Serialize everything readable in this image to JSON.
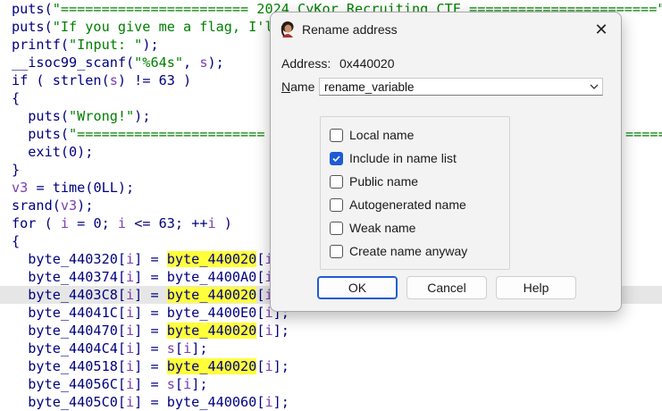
{
  "code_lines": [
    {
      "parts": [
        {
          "t": "puts(",
          "c": ""
        },
        {
          "t": "\"======================= 2024 CyKor Recruiting CTF =======================\"",
          "c": "str"
        },
        {
          "t": ");",
          "c": ""
        }
      ]
    },
    {
      "parts": [
        {
          "t": "puts(",
          "c": ""
        },
        {
          "t": "\"If you give me a flag, I'l",
          "c": "str"
        }
      ]
    },
    {
      "parts": [
        {
          "t": "printf(",
          "c": ""
        },
        {
          "t": "\"Input: \"",
          "c": "str"
        },
        {
          "t": ");",
          "c": ""
        }
      ]
    },
    {
      "parts": [
        {
          "t": "__isoc99_scanf(",
          "c": ""
        },
        {
          "t": "\"%64s\"",
          "c": "str"
        },
        {
          "t": ", ",
          "c": ""
        },
        {
          "t": "s",
          "c": "pv"
        },
        {
          "t": ");",
          "c": ""
        }
      ]
    },
    {
      "parts": [
        {
          "t": "if ( strlen(",
          "c": ""
        },
        {
          "t": "s",
          "c": "pv"
        },
        {
          "t": ") != 63 )",
          "c": ""
        }
      ]
    },
    {
      "parts": [
        {
          "t": "{",
          "c": ""
        }
      ]
    },
    {
      "parts": [
        {
          "t": "  puts(",
          "c": ""
        },
        {
          "t": "\"Wrong!\"",
          "c": "str"
        },
        {
          "t": ");",
          "c": ""
        }
      ]
    },
    {
      "parts": [
        {
          "t": "  puts(",
          "c": ""
        },
        {
          "t": "\"=======================",
          "c": "str"
        }
      ],
      "right": "=====\""
    },
    {
      "parts": [
        {
          "t": "  exit(0);",
          "c": ""
        }
      ]
    },
    {
      "parts": [
        {
          "t": "}",
          "c": ""
        }
      ]
    },
    {
      "parts": [
        {
          "t": "v3",
          "c": "pv"
        },
        {
          "t": " = time(0LL);",
          "c": ""
        }
      ]
    },
    {
      "parts": [
        {
          "t": "srand(",
          "c": ""
        },
        {
          "t": "v3",
          "c": "pv"
        },
        {
          "t": ");",
          "c": ""
        }
      ]
    },
    {
      "parts": [
        {
          "t": "for ( ",
          "c": ""
        },
        {
          "t": "i",
          "c": "pv"
        },
        {
          "t": " = 0; ",
          "c": ""
        },
        {
          "t": "i",
          "c": "pv"
        },
        {
          "t": " <= 63; ++",
          "c": ""
        },
        {
          "t": "i",
          "c": "pv"
        },
        {
          "t": " )",
          "c": ""
        }
      ]
    },
    {
      "parts": [
        {
          "t": "{",
          "c": ""
        }
      ]
    },
    {
      "parts": [
        {
          "t": "  byte_440320[",
          "c": ""
        },
        {
          "t": "i",
          "c": "pv"
        },
        {
          "t": "] = ",
          "c": ""
        },
        {
          "t": "byte_440020",
          "c": "hl"
        },
        {
          "t": "[",
          "c": ""
        },
        {
          "t": "i",
          "c": "pv"
        }
      ]
    },
    {
      "parts": [
        {
          "t": "  byte_440374[",
          "c": ""
        },
        {
          "t": "i",
          "c": "pv"
        },
        {
          "t": "] = byte_4400A0[",
          "c": ""
        },
        {
          "t": "i",
          "c": "pv"
        }
      ]
    },
    {
      "parts": [
        {
          "t": "  byte_4403C8[",
          "c": ""
        },
        {
          "t": "i",
          "c": "pv"
        },
        {
          "t": "] = ",
          "c": ""
        },
        {
          "t": "byte_440020",
          "c": "hl"
        },
        {
          "t": "[",
          "c": ""
        },
        {
          "t": "i",
          "c": "pv"
        }
      ],
      "current": true
    },
    {
      "parts": [
        {
          "t": "  byte_44041C[",
          "c": ""
        },
        {
          "t": "i",
          "c": "pv"
        },
        {
          "t": "] = byte_4400E0[",
          "c": ""
        },
        {
          "t": "i",
          "c": "pv"
        },
        {
          "t": "];",
          "c": ""
        }
      ]
    },
    {
      "parts": [
        {
          "t": "  byte_440470[",
          "c": ""
        },
        {
          "t": "i",
          "c": "pv"
        },
        {
          "t": "] = ",
          "c": ""
        },
        {
          "t": "byte_440020",
          "c": "hl"
        },
        {
          "t": "[",
          "c": ""
        },
        {
          "t": "i",
          "c": "pv"
        },
        {
          "t": "];",
          "c": ""
        }
      ]
    },
    {
      "parts": [
        {
          "t": "  byte_4404C4[",
          "c": ""
        },
        {
          "t": "i",
          "c": "pv"
        },
        {
          "t": "] = ",
          "c": ""
        },
        {
          "t": "s",
          "c": "pv"
        },
        {
          "t": "[",
          "c": ""
        },
        {
          "t": "i",
          "c": "pv"
        },
        {
          "t": "];",
          "c": ""
        }
      ]
    },
    {
      "parts": [
        {
          "t": "  byte_440518[",
          "c": ""
        },
        {
          "t": "i",
          "c": "pv"
        },
        {
          "t": "] = ",
          "c": ""
        },
        {
          "t": "byte_440020",
          "c": "hl"
        },
        {
          "t": "[",
          "c": ""
        },
        {
          "t": "i",
          "c": "pv"
        },
        {
          "t": "];",
          "c": ""
        }
      ]
    },
    {
      "parts": [
        {
          "t": "  byte_44056C[",
          "c": ""
        },
        {
          "t": "i",
          "c": "pv"
        },
        {
          "t": "] = ",
          "c": ""
        },
        {
          "t": "s",
          "c": "pv"
        },
        {
          "t": "[",
          "c": ""
        },
        {
          "t": "i",
          "c": "pv"
        },
        {
          "t": "];",
          "c": ""
        }
      ]
    },
    {
      "parts": [
        {
          "t": "  byte_4405C0[",
          "c": ""
        },
        {
          "t": "i",
          "c": "pv"
        },
        {
          "t": "] = byte_440060[",
          "c": ""
        },
        {
          "t": "i",
          "c": "pv"
        },
        {
          "t": "];",
          "c": ""
        }
      ]
    }
  ],
  "dialog": {
    "title": "Rename address",
    "address_label": "Address:",
    "address_value": "0x440020",
    "name_label_underlined": "N",
    "name_label_rest": "ame",
    "name_value": "rename_variable",
    "options": [
      {
        "label": "Local name",
        "checked": false
      },
      {
        "label": "Include in name list",
        "checked": true
      },
      {
        "label": "Public name",
        "checked": false
      },
      {
        "label": "Autogenerated name",
        "checked": false
      },
      {
        "label": "Weak name",
        "checked": false
      },
      {
        "label": "Create name anyway",
        "checked": false
      }
    ],
    "buttons": {
      "ok": "OK",
      "cancel": "Cancel",
      "help": "Help"
    }
  },
  "colors": {
    "accent": "#1e5bd4",
    "highlight": "#ffff3a",
    "string": "#008000",
    "variable": "#7a40b0",
    "code": "#000080"
  }
}
